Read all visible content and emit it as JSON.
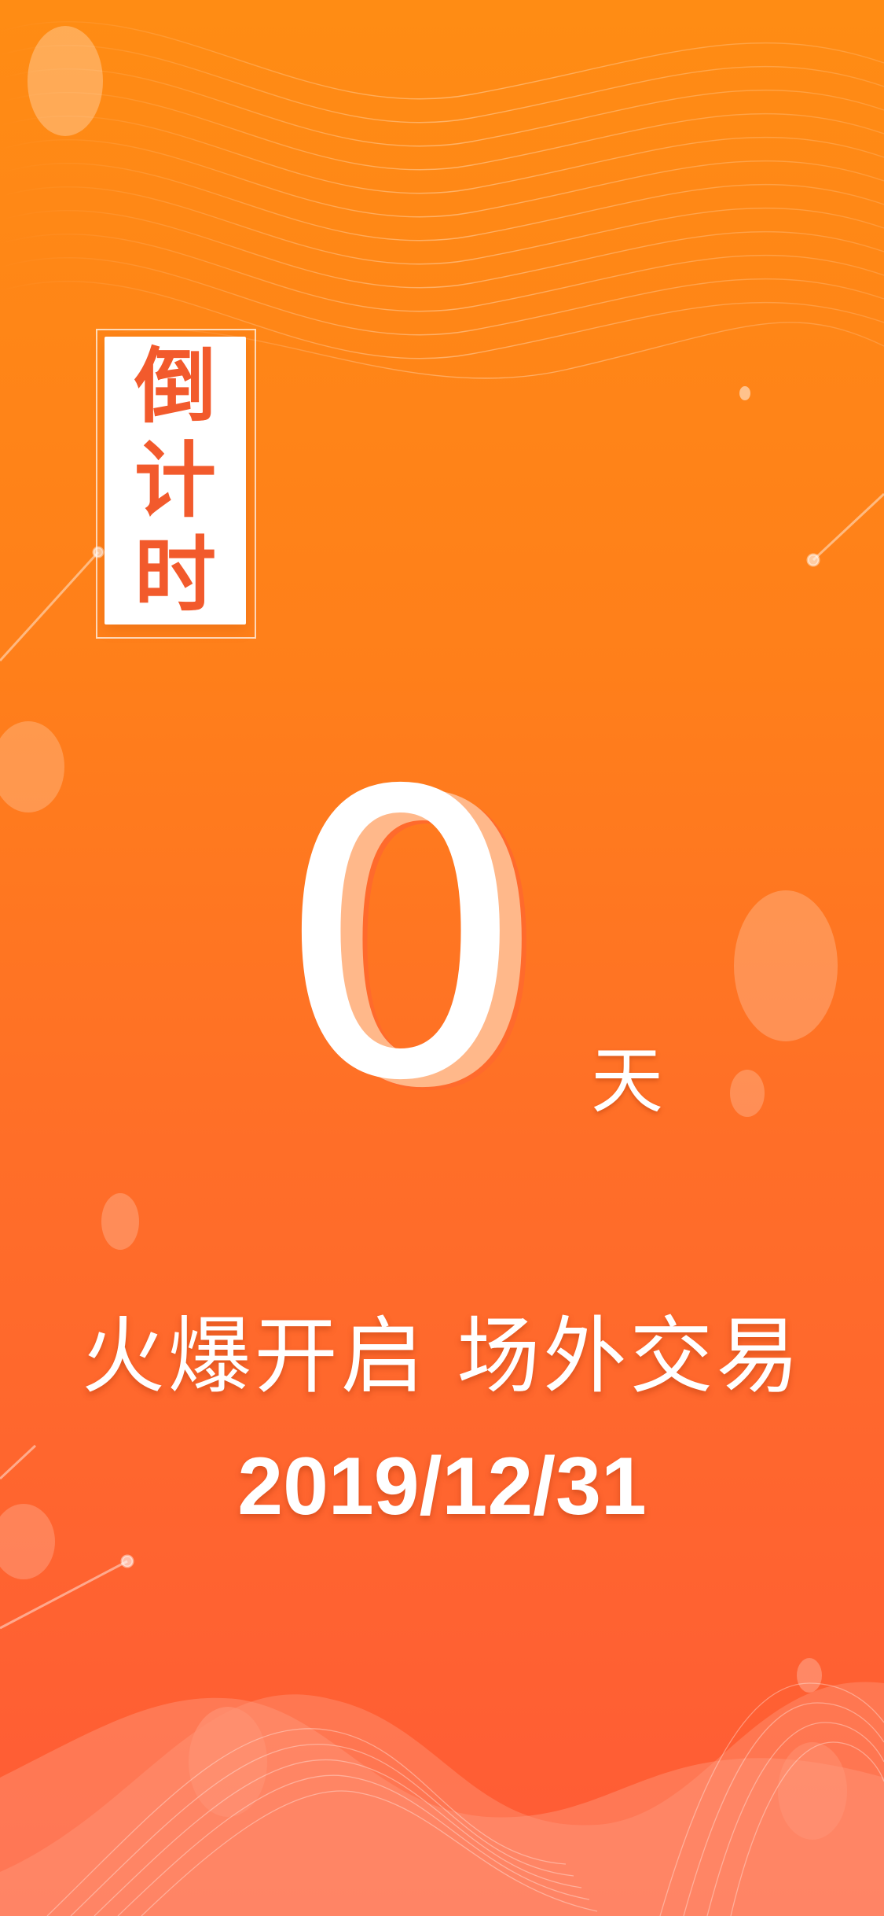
{
  "poster": {
    "title_chars": [
      "倒",
      "计",
      "时"
    ],
    "days": "0",
    "days_unit": "天",
    "slogan": "火爆开启 场外交易",
    "date": "2019/12/31"
  },
  "colors": {
    "gradient_top": "#ff8c14",
    "gradient_bottom": "#ff5a37",
    "title_text": "#f25a2c",
    "text": "#ffffff"
  }
}
